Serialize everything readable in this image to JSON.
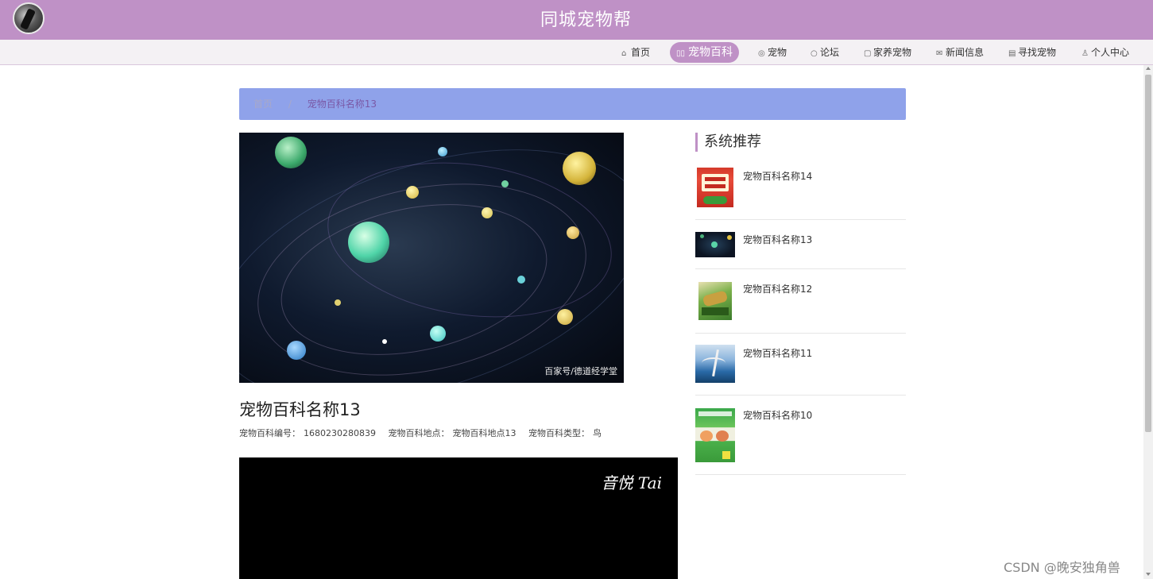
{
  "header": {
    "title": "同城宠物帮"
  },
  "nav": [
    {
      "icon": "home-icon",
      "glyph": "⌂",
      "label": "首页"
    },
    {
      "icon": "book-icon",
      "glyph": "▯▯",
      "label": "宠物百科",
      "active": true
    },
    {
      "icon": "globe-icon",
      "glyph": "◎",
      "label": "宠物"
    },
    {
      "icon": "chat-bubble-icon",
      "glyph": "○",
      "label": "论坛"
    },
    {
      "icon": "notebook-icon",
      "glyph": "▢",
      "label": "家养宠物"
    },
    {
      "icon": "mail-icon",
      "glyph": "✉",
      "label": "新闻信息"
    },
    {
      "icon": "calendar-icon",
      "glyph": "▤",
      "label": "寻找宠物"
    },
    {
      "icon": "user-icon",
      "glyph": "♙",
      "label": "个人中心"
    }
  ],
  "breadcrumb": {
    "home": "首页",
    "separator": "/",
    "current": "宠物百科名称13"
  },
  "hero": {
    "watermark": "百家号/德道经学堂"
  },
  "detail": {
    "title": "宠物百科名称13",
    "number_label": "宠物百科编号：",
    "number_value": "1680230280839",
    "location_label": "宠物百科地点：",
    "location_value": "宠物百科地点13",
    "type_label": "宠物百科类型：",
    "type_value": "鸟"
  },
  "video": {
    "overlay_text": "音悦 Tai"
  },
  "sidebar": {
    "heading": "系统推荐",
    "items": [
      {
        "name": "宠物百科名称14",
        "thumb": "book-cover-red"
      },
      {
        "name": "宠物百科名称13",
        "thumb": "galaxy"
      },
      {
        "name": "宠物百科名称12",
        "thumb": "book-cover-dinosaur"
      },
      {
        "name": "宠物百科名称11",
        "thumb": "sea-landscape"
      },
      {
        "name": "宠物百科名称10",
        "thumb": "book-cover-green"
      }
    ]
  },
  "footer_watermark": "CSDN @晚安独角兽",
  "colors": {
    "header_bg": "#bf91c6",
    "breadcrumb_bg": "#8fa2ea",
    "accent": "#bf91c6"
  }
}
